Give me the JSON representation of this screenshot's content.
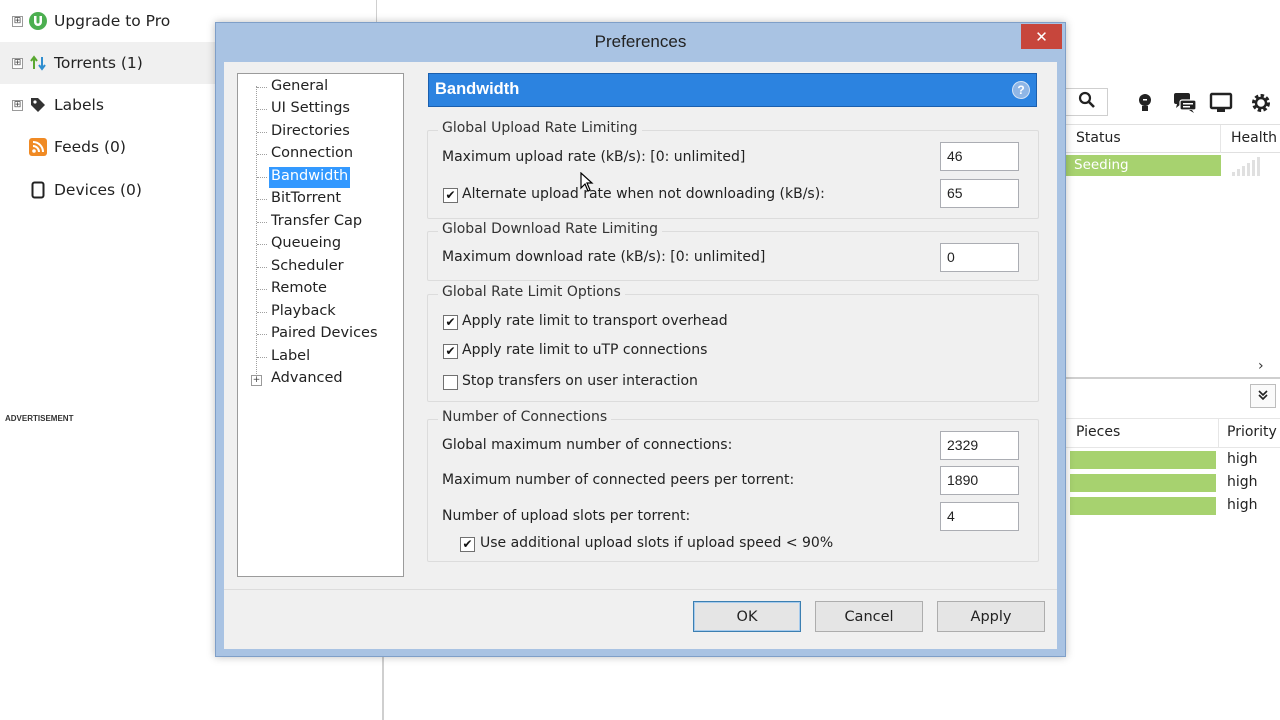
{
  "sidebar": {
    "items": [
      {
        "label": "Upgrade to Pro",
        "icon": "utorrent-logo-icon",
        "expander": "⊞"
      },
      {
        "label": "Torrents (1)",
        "icon": "torrents-arrows-icon",
        "expander": "⊞"
      },
      {
        "label": "Labels",
        "icon": "tag-icon",
        "expander": "⊞"
      },
      {
        "label": "Feeds (0)",
        "icon": "rss-icon",
        "expander": ""
      },
      {
        "label": "Devices (0)",
        "icon": "device-icon",
        "expander": ""
      }
    ],
    "ad_label": "ADVERTISEMENT"
  },
  "main": {
    "torrent_list": {
      "columns": [
        "Status",
        "Health"
      ],
      "rows": [
        {
          "status": "Seeding"
        }
      ]
    },
    "scroll_right_glyph": "›",
    "panel_toggle_glyph": "⌄",
    "files": {
      "columns": [
        "Pieces",
        "Priority"
      ],
      "rows": [
        {
          "priority": "high",
          "pieces_progress": 1.0
        },
        {
          "priority": "high",
          "pieces_progress": 1.0
        },
        {
          "priority": "high",
          "pieces_progress": 1.0
        }
      ]
    }
  },
  "dialog": {
    "title": "Preferences",
    "close_glyph": "✕",
    "tree": {
      "items": [
        "General",
        "UI Settings",
        "Directories",
        "Connection",
        "Bandwidth",
        "BitTorrent",
        "Transfer Cap",
        "Queueing",
        "Scheduler",
        "Remote",
        "Playback",
        "Paired Devices",
        "Label",
        "Advanced"
      ],
      "selected": "Bandwidth",
      "expander": "+"
    },
    "section_title": "Bandwidth",
    "help_glyph": "?",
    "upload": {
      "title": "Global Upload Rate Limiting",
      "max_label": "Maximum upload rate (kB/s): [0: unlimited]",
      "max_value": "46",
      "alt_label": "Alternate upload rate when not downloading (kB/s):",
      "alt_checked": true,
      "alt_value": "65"
    },
    "download": {
      "title": "Global Download Rate Limiting",
      "max_label": "Maximum download rate (kB/s): [0: unlimited]",
      "max_value": "0"
    },
    "options": {
      "title": "Global Rate Limit Options",
      "transport_label": "Apply rate limit to transport overhead",
      "transport_checked": true,
      "utp_label": "Apply rate limit to uTP connections",
      "utp_checked": true,
      "stop_label": "Stop transfers on user interaction",
      "stop_checked": false
    },
    "connections": {
      "title": "Number of Connections",
      "global_label": "Global maximum number of connections:",
      "global_value": "2329",
      "peers_label": "Maximum number of connected peers per torrent:",
      "peers_value": "1890",
      "slots_label": "Number of upload slots per torrent:",
      "slots_value": "4",
      "additional_label": "Use additional upload slots if upload speed < 90%",
      "additional_checked": true
    },
    "buttons": {
      "ok": "OK",
      "cancel": "Cancel",
      "apply": "Apply"
    },
    "check_glyph": "✔"
  },
  "colors": {
    "accent": "#2c83e0",
    "selection": "#3399ff",
    "seeding": "#a7d26f",
    "close": "#c7463c",
    "dialog_frame": "#a9c3e3"
  }
}
